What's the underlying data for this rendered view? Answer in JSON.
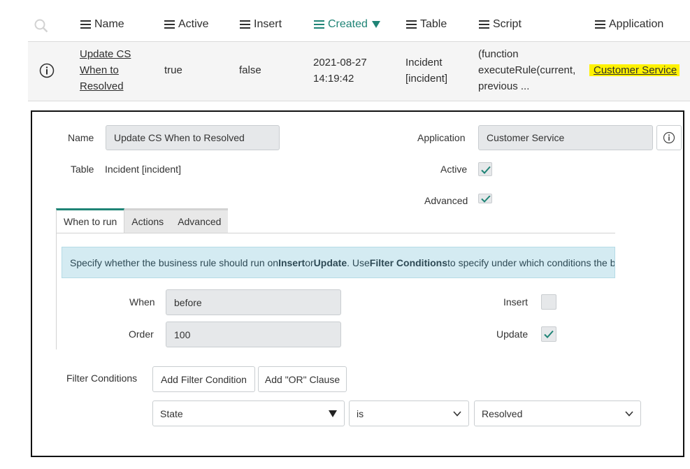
{
  "list": {
    "columns": [
      {
        "label": "Name"
      },
      {
        "label": "Active"
      },
      {
        "label": "Insert"
      },
      {
        "label": "Created"
      },
      {
        "label": "Table"
      },
      {
        "label": "Script"
      },
      {
        "label": "Application"
      }
    ],
    "row": {
      "name_lines": [
        "Update CS",
        "When to",
        "Resolved"
      ],
      "active": "true",
      "insert": "false",
      "created_date": "2021-08-27",
      "created_time": "14:19:42",
      "table_lines": [
        "Incident",
        "[incident]"
      ],
      "script_lines": [
        "(function",
        "executeRule(current,",
        "previous ..."
      ],
      "application": "Customer Service"
    },
    "highlight_color": "#fff200",
    "sort_color": "#1f8476"
  },
  "form": {
    "name_label": "Name",
    "name_value": "Update CS When to Resolved",
    "table_label": "Table",
    "table_value": "Incident [incident]",
    "application_label": "Application",
    "application_value": "Customer Service",
    "active_label": "Active",
    "advanced_label": "Advanced",
    "tabs": [
      "When to run",
      "Actions",
      "Advanced"
    ],
    "banner": {
      "t1": "Specify whether the business rule should run on ",
      "b1": "Insert",
      "t2": " or ",
      "b2": "Update",
      "t3": ". Use ",
      "b3": "Filter Conditions",
      "t4": " to specify under which conditions the b"
    },
    "when_label": "When",
    "when_value": "before",
    "order_label": "Order",
    "order_value": "100",
    "insert_label": "Insert",
    "update_label": "Update",
    "filter_label": "Filter Conditions",
    "add_filter_btn": "Add Filter Condition",
    "add_or_btn": "Add \"OR\" Clause",
    "condition": {
      "field": "State",
      "operator": "is",
      "value": "Resolved"
    }
  }
}
